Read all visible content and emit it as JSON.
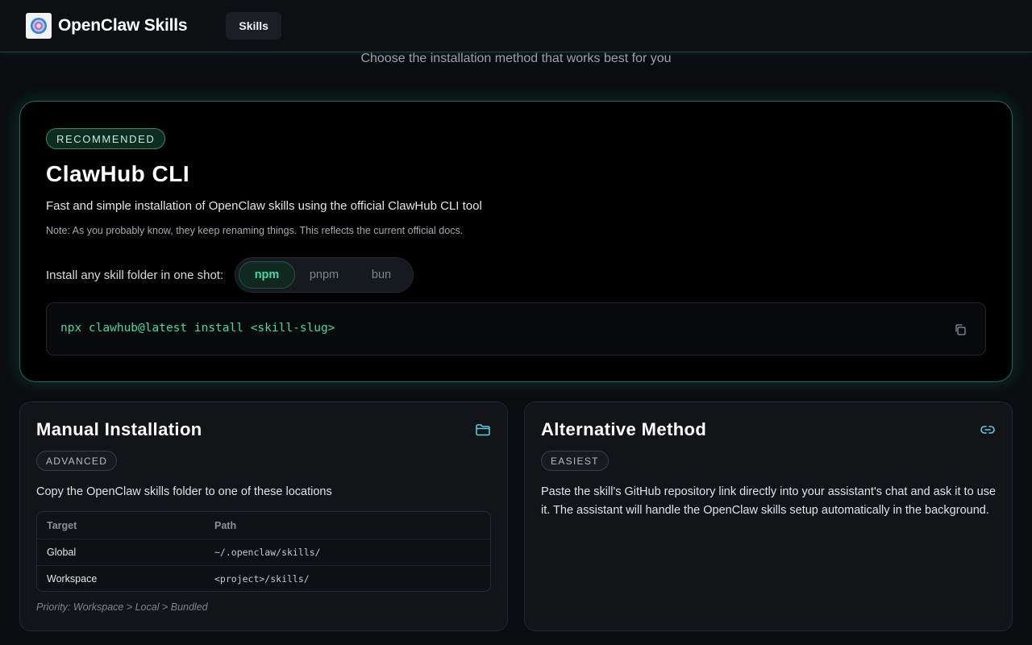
{
  "header": {
    "brand": "OpenClaw Skills",
    "nav_skills": "Skills"
  },
  "subtitle": "Choose the installation method that works best for you",
  "recommended": {
    "badge": "RECOMMENDED",
    "title": "ClawHub CLI",
    "description": "Fast and simple installation of OpenClaw skills using the official ClawHub CLI tool",
    "note": "Note: As you probably know, they keep renaming things. This reflects the current official docs.",
    "install_label": "Install any skill folder in one shot:",
    "package_managers": [
      "npm",
      "pnpm",
      "bun"
    ],
    "selected_pm": "npm",
    "command": "npx clawhub@latest install <skill-slug>",
    "copy_icon": "copy-icon"
  },
  "manual": {
    "title": "Manual Installation",
    "icon": "folder-icon",
    "badge": "ADVANCED",
    "description": "Copy the OpenClaw skills folder to one of these locations",
    "table": {
      "headers": [
        "Target",
        "Path"
      ],
      "rows": [
        [
          "Global",
          "~/.openclaw/skills/"
        ],
        [
          "Workspace",
          "<project>/skills/"
        ]
      ]
    },
    "priority": "Priority: Workspace > Local > Bundled"
  },
  "alternative": {
    "title": "Alternative Method",
    "icon": "link-icon",
    "badge": "EASIEST",
    "description": "Paste the skill's GitHub repository link directly into your assistant's chat and ask it to use it. The assistant will handle the OpenClaw skills setup automatically in the background."
  },
  "colors": {
    "accent": "#3fdca6",
    "icon_accent": "#5ad1e6",
    "background": "#0b0c0f"
  }
}
